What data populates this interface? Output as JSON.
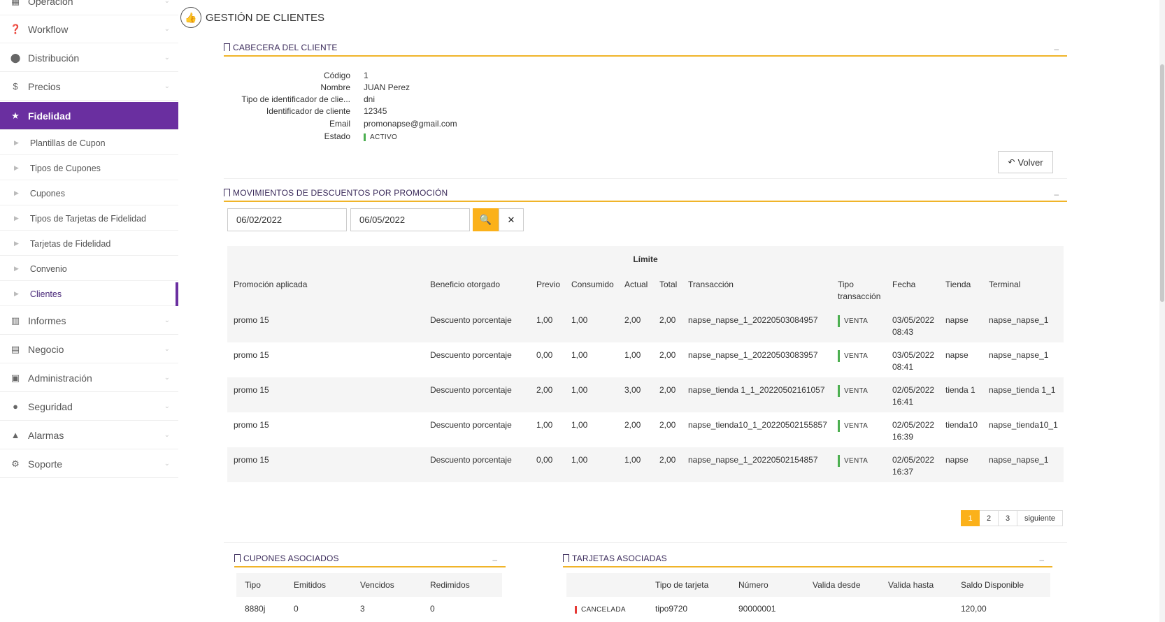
{
  "sidebar": {
    "items": [
      {
        "label": "Operación",
        "icon": "grid-icon"
      },
      {
        "label": "Workflow",
        "icon": "question-circle-icon"
      },
      {
        "label": "Distribución",
        "icon": "map-marker-icon"
      },
      {
        "label": "Precios",
        "icon": "dollar-icon"
      },
      {
        "label": "Fidelidad",
        "icon": "star-icon"
      },
      {
        "label": "Informes",
        "icon": "bar-chart-icon"
      },
      {
        "label": "Negocio",
        "icon": "building-icon"
      },
      {
        "label": "Administración",
        "icon": "calendar-check-icon"
      },
      {
        "label": "Seguridad",
        "icon": "users-icon"
      },
      {
        "label": "Alarmas",
        "icon": "bell-icon"
      },
      {
        "label": "Soporte",
        "icon": "gear-icon"
      }
    ],
    "subitems": [
      "Plantillas de Cupon",
      "Tipos de Cupones",
      "Cupones",
      "Tipos de Tarjetas de Fidelidad",
      "Tarjetas de Fidelidad",
      "Convenio",
      "Clientes"
    ]
  },
  "page": {
    "title": "GESTIÓN DE CLIENTES"
  },
  "cabecera": {
    "title": "CABECERA DEL CLIENTE",
    "minimize": "–",
    "fields": [
      {
        "label": "Código",
        "value": "1"
      },
      {
        "label": "Nombre",
        "value": "JUAN Perez"
      },
      {
        "label": "Tipo de identificador de clie...",
        "value": "dni"
      },
      {
        "label": "Identificador de cliente",
        "value": "12345"
      },
      {
        "label": "Email",
        "value": "promonapse@gmail.com"
      },
      {
        "label": "Estado",
        "value": "ACTIVO"
      }
    ],
    "volver_label": "Volver"
  },
  "movimientos": {
    "title": "MOVIMIENTOS DE DESCUENTOS POR PROMOCIÓN",
    "minimize": "–",
    "date_from": "06/02/2022",
    "date_to": "06/05/2022",
    "group_header": "Límite",
    "columns": [
      "Promoción aplicada",
      "Beneficio otorgado",
      "Previo",
      "Consumido",
      "Actual",
      "Total",
      "Transacción",
      "Tipo transacción",
      "Fecha",
      "Tienda",
      "Terminal"
    ],
    "rows": [
      [
        "promo 15",
        "Descuento porcentaje",
        "1,00",
        "1,00",
        "2,00",
        "2,00",
        "napse_napse_1_20220503084957",
        "VENTA",
        "03/05/2022 08:43",
        "napse",
        "napse_napse_1"
      ],
      [
        "promo 15",
        "Descuento porcentaje",
        "0,00",
        "1,00",
        "1,00",
        "2,00",
        "napse_napse_1_20220503083957",
        "VENTA",
        "03/05/2022 08:41",
        "napse",
        "napse_napse_1"
      ],
      [
        "promo 15",
        "Descuento porcentaje",
        "2,00",
        "1,00",
        "3,00",
        "2,00",
        "napse_tienda 1_1_20220502161057",
        "VENTA",
        "02/05/2022 16:41",
        "tienda 1",
        "napse_tienda 1_1"
      ],
      [
        "promo 15",
        "Descuento porcentaje",
        "1,00",
        "1,00",
        "2,00",
        "2,00",
        "napse_tienda10_1_20220502155857",
        "VENTA",
        "02/05/2022 16:39",
        "tienda10",
        "napse_tienda10_1"
      ],
      [
        "promo 15",
        "Descuento porcentaje",
        "0,00",
        "1,00",
        "1,00",
        "2,00",
        "napse_napse_1_20220502154857",
        "VENTA",
        "02/05/2022 16:37",
        "napse",
        "napse_napse_1"
      ]
    ],
    "pages": [
      "1",
      "2",
      "3"
    ],
    "next_label": "siguiente"
  },
  "cupones": {
    "title": "CUPONES ASOCIADOS",
    "minimize": "–",
    "columns": [
      "Tipo",
      "Emitidos",
      "Vencidos",
      "Redimidos"
    ],
    "rows": [
      [
        "8880j",
        "0",
        "3",
        "0"
      ]
    ]
  },
  "tarjetas": {
    "title": "TARJETAS ASOCIADAS",
    "minimize": "–",
    "columns": [
      "",
      "Tipo de tarjeta",
      "Número",
      "Valida desde",
      "Valida hasta",
      "Saldo Disponible"
    ],
    "rows": [
      [
        "CANCELADA",
        "tipo9720",
        "90000001",
        "",
        "",
        "120,00"
      ]
    ]
  },
  "colors": {
    "accent": "#6a2fa0",
    "highlight": "#fbb11a",
    "active_status": "#4caf50",
    "cancel_status": "#e53935"
  }
}
